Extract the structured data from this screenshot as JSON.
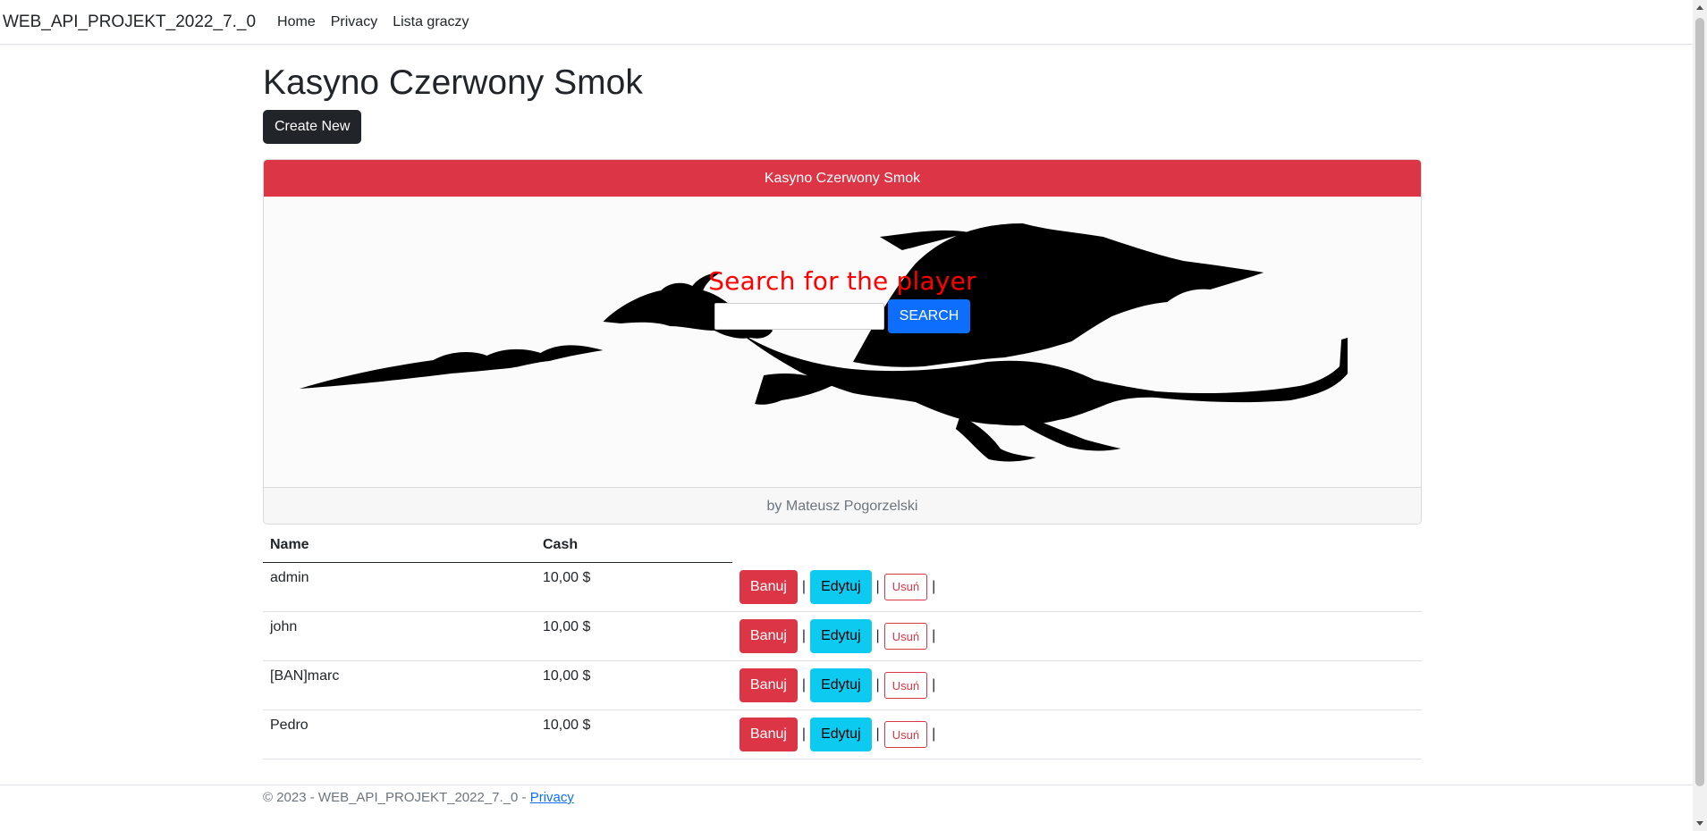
{
  "navbar": {
    "brand": "WEB_API_PROJEKT_2022_7._0",
    "links": [
      "Home",
      "Privacy",
      "Lista graczy"
    ]
  },
  "page": {
    "title": "Kasyno Czerwony Smok",
    "create_label": "Create New"
  },
  "card": {
    "header": "Kasyno Czerwony Smok",
    "search_title": "Search for the player",
    "search_value": "",
    "search_button": "SEARCH",
    "footer": "by Mateusz Pogorzelski",
    "image": "dragon-silhouette"
  },
  "table": {
    "headers": [
      "Name",
      "Cash"
    ],
    "rows": [
      {
        "name": "admin",
        "cash": "10,00 $"
      },
      {
        "name": "john",
        "cash": "10,00 $"
      },
      {
        "name": "[BAN]marc",
        "cash": "10,00 $"
      },
      {
        "name": "Pedro",
        "cash": "10,00 $"
      }
    ],
    "actions": {
      "ban": "Banuj",
      "edit": "Edytuj",
      "delete": "Usuń",
      "separator": "|"
    }
  },
  "footer": {
    "text": "© 2023 - WEB_API_PROJEKT_2022_7._0 - ",
    "link": "Privacy"
  },
  "colors": {
    "header_red": "#dc3545",
    "search_title_red": "#ff0000",
    "primary_blue": "#0d6efd",
    "info_cyan": "#0dcaf0",
    "dark": "#212529"
  }
}
